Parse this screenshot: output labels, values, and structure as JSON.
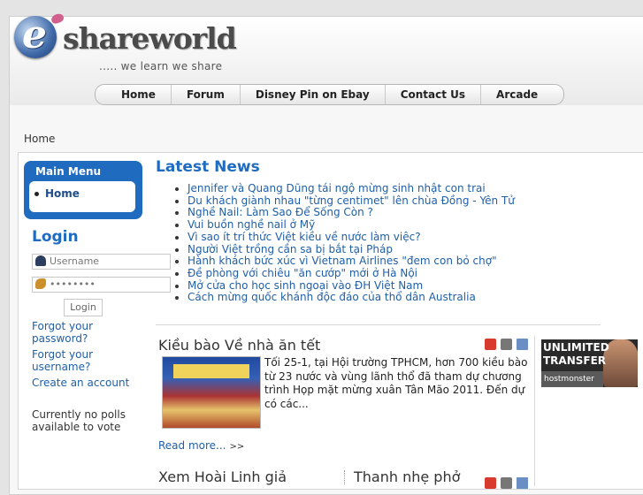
{
  "site": {
    "logo_word": "shareworld",
    "logo_letter": "e",
    "tagline": "..... we learn we share"
  },
  "nav": {
    "items": [
      "Home",
      "Forum",
      "Disney Pin on Ebay",
      "Contact Us",
      "Arcade"
    ]
  },
  "breadcrumb": "Home",
  "main_menu": {
    "title": "Main Menu",
    "items": [
      "Home"
    ]
  },
  "login": {
    "title": "Login",
    "username_placeholder": "Username",
    "password_value": "••••••••",
    "button": "Login",
    "forgot_password": "Forgot your password?",
    "forgot_username": "Forgot your username?",
    "create_account": "Create an account"
  },
  "polls": {
    "text": "Currently no polls available to vote"
  },
  "latest_news": {
    "title": "Latest News",
    "items": [
      "Jennifer và Quang Dũng tái ngộ mừng sinh nhật con trai",
      "Du khách giành nhau \"từng centimet\" lên chùa Đồng - Yên Tử",
      "Nghề Nail: Làm Sao Để Sống Còn ?",
      "Vui buồn nghề nail ở Mỹ",
      "Vì sao ít trí thức Việt kiều về nước làm việc?",
      "Người Việt trồng cần sa bị bắt tại Pháp",
      "Hành khách bức xúc vì Vietnam Airlines \"đem con bỏ chợ\"",
      "Đề phòng với chiêu \"ăn cướp\" mới ở Hà Nội",
      "Mở cửa cho học sinh ngoại vào ĐH Việt Nam",
      "Cách mừng quốc khánh độc đáo của thổ dân Australia"
    ]
  },
  "article": {
    "title": "Kiều bào Về nhà ăn tết",
    "text": "Tối 25-1, tại Hội trường TPHCM, hơn 700 kiều bào từ 23 nước và vùng lãnh thổ đã tham dự chương trình Họp mặt mừng xuân Tân Mão 2011. Đến dự có các...",
    "read_more": "Read more...",
    "read_more_arrow": ">>",
    "icons": [
      "pdf-icon",
      "print-icon",
      "email-icon"
    ]
  },
  "ad": {
    "line1": "UNLIMITED",
    "line2": "TRANSFER",
    "brand": "hostmonster"
  },
  "bottom": {
    "left_title": "Xem Hoài Linh giả",
    "right_title": "Thanh nhẹ phở"
  },
  "colors": {
    "accent": "#1f6bc0",
    "link": "#1f5fa8"
  }
}
